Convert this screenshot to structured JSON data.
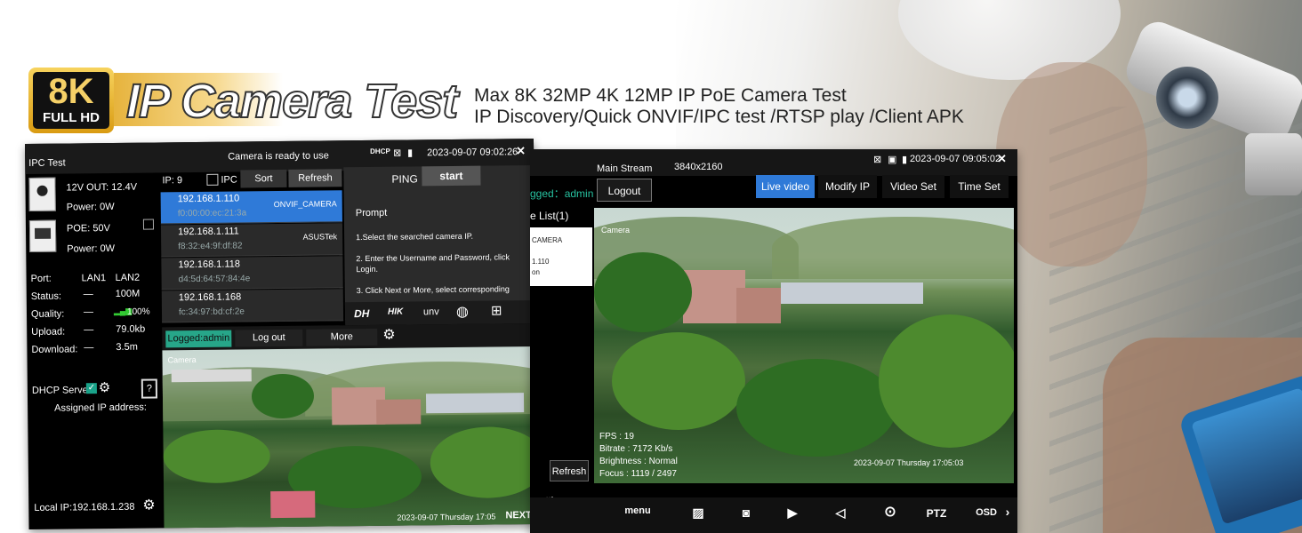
{
  "banner": {
    "badge_top": "8K",
    "badge_bottom": "FULL HD",
    "title": "IP Camera Test",
    "line1": "Max 8K 32MP 4K 12MP IP PoE Camera Test",
    "line2": "IP Discovery/Quick ONVIF/IPC test /RTSP play /Client APK"
  },
  "left_screen": {
    "title": "IPC Test",
    "status_msg": "Camera is ready to use",
    "dhcp": "DHCP",
    "datetime": "2023-09-07 09:02:26",
    "out12": "12V OUT: 12.4V",
    "power1": "Power: 0W",
    "poe": "POE: 50V",
    "power2": "Power: 0W",
    "table_headers": [
      "Port:",
      "LAN1",
      "LAN2"
    ],
    "table_rows": [
      {
        "label": "Status:",
        "lan1": "—",
        "lan2": "100M"
      },
      {
        "label": "Quality:",
        "lan1": "—",
        "lan2": "100%"
      },
      {
        "label": "Upload:",
        "lan1": "—",
        "lan2": "79.0kb"
      },
      {
        "label": "Download:",
        "lan1": "—",
        "lan2": "3.5m"
      }
    ],
    "dhcp_server": "DHCP Server:",
    "assigned": "Assigned IP address:",
    "local_ip": "Local IP:192.168.1.238",
    "ip_count": "IP: 9",
    "ipc_check": "IPC",
    "sort": "Sort",
    "refresh": "Refresh",
    "devices": [
      {
        "ip": "192.168.1.110",
        "mac": "f0:00:00:ec:21:3a",
        "name": "ONVIF_CAMERA"
      },
      {
        "ip": "192.168.1.111",
        "mac": "f8:32:e4:9f:df:82",
        "name": "ASUSTek"
      },
      {
        "ip": "192.168.1.118",
        "mac": "d4:5d:64:57:84:4e",
        "name": ""
      },
      {
        "ip": "192.168.1.168",
        "mac": "fc:34:97:bd:cf:2e",
        "name": ""
      }
    ],
    "ping": "PING",
    "start": "start",
    "prompt_title": "Prompt",
    "prompt1": "1.Select the searched camera IP.",
    "prompt2a": "2. Enter the Username and Password, click",
    "prompt2b": "Login.",
    "prompt3": "3. Click Next or More, select corresponding",
    "brands": [
      "DH",
      "HIK",
      "unv"
    ],
    "logged": "Logged:admin",
    "logout": "Log out",
    "more": "More",
    "video_label": "Camera",
    "video_stamp": "2023-09-07 Thursday 17:05",
    "next": "NEXT"
  },
  "right_screen": {
    "stream": "Main Stream",
    "resolution": "3840x2160",
    "datetime": "2023-09-07 09:05:02",
    "logged": "gged：admin",
    "logout": "Logout",
    "tabs": [
      "Live video",
      "Modify IP",
      "Video Set",
      "Time Set"
    ],
    "device_list": "e List(1)",
    "dev_name": "CAMERA",
    "dev_ip": "1.110",
    "dev_on": "on",
    "refresh": "Refresh",
    "setting": "setting",
    "video_label": "Camera",
    "fps": "FPS : 19",
    "bitrate": "Bitrate : 7172 Kb/s",
    "brightness": "Brightness : Normal",
    "focus": "Focus : 1119 / 2497",
    "stamp": "2023-09-07 Thursday 17:05:03",
    "toolbar": [
      "menu",
      "PTZ",
      "OSD"
    ]
  },
  "colors": {
    "accent_blue": "#2f7ad8",
    "logged_green": "#27a689",
    "gold": "#e2a61b"
  }
}
